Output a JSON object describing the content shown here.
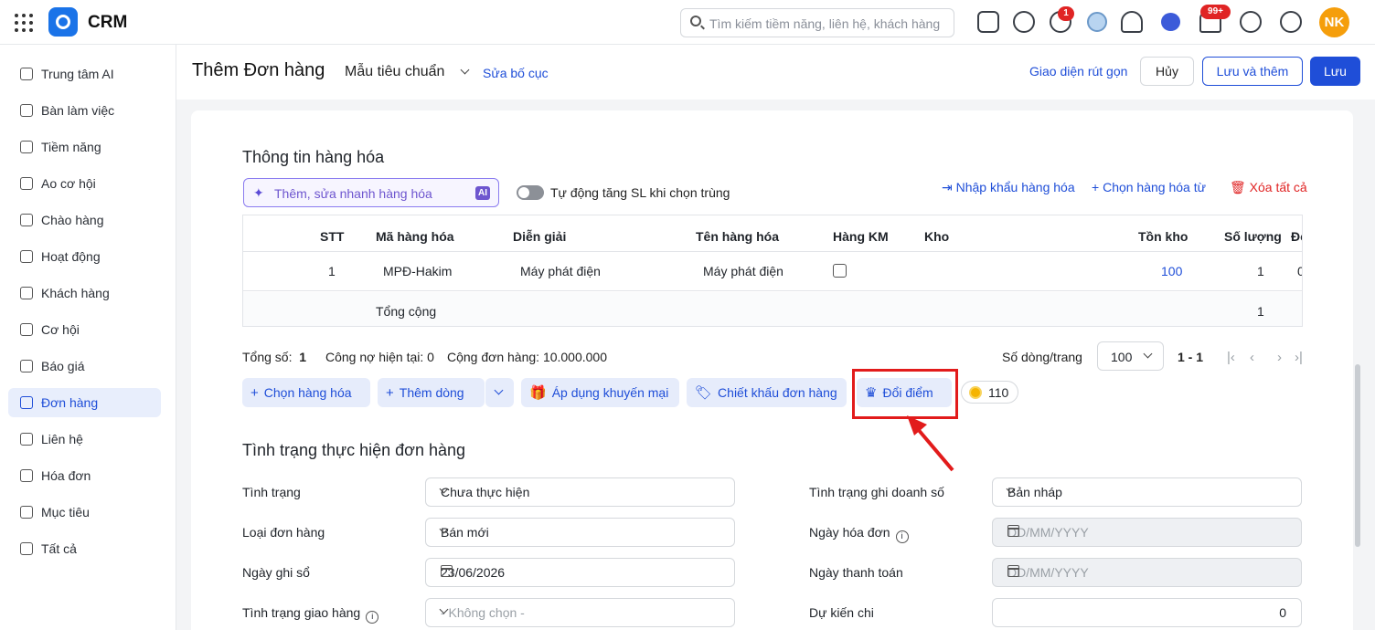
{
  "app": {
    "brand": "CRM"
  },
  "search": {
    "placeholder": "Tìm kiếm tiềm năng, liên hệ, khách hàng"
  },
  "notifications": {
    "timer_badge": "1",
    "bell_badge": "99+"
  },
  "user": {
    "initials": "NK"
  },
  "sidebar": {
    "items": [
      {
        "label": "Trung tâm AI",
        "icon": "sparkle-icon"
      },
      {
        "label": "Bàn làm việc",
        "icon": "home-icon"
      },
      {
        "label": "Tiềm năng",
        "icon": "user-circle-icon"
      },
      {
        "label": "Ao cơ hội",
        "icon": "people-icon"
      },
      {
        "label": "Chào hàng",
        "icon": "magnet-icon"
      },
      {
        "label": "Hoạt động",
        "icon": "activity-icon"
      },
      {
        "label": "Khách hàng",
        "icon": "building-icon"
      },
      {
        "label": "Cơ hội",
        "icon": "box-icon"
      },
      {
        "label": "Báo giá",
        "icon": "quote-doc-icon"
      },
      {
        "label": "Đơn hàng",
        "icon": "cart-icon"
      },
      {
        "label": "Liên hệ",
        "icon": "contact-icon"
      },
      {
        "label": "Hóa đơn",
        "icon": "invoice-icon"
      },
      {
        "label": "Mục tiêu",
        "icon": "target-icon"
      },
      {
        "label": "Tất cả",
        "icon": "menu-icon"
      }
    ],
    "active_index": 9
  },
  "header": {
    "title": "Thêm Đơn hàng",
    "template": "Mẫu tiêu chuẩn",
    "edit_layout": "Sửa bố cục",
    "compact_view": "Giao diện rút gọn",
    "cancel": "Hủy",
    "save_and_add": "Lưu và thêm",
    "save": "Lưu"
  },
  "goods": {
    "section_title": "Thông tin hàng hóa",
    "ai_placeholder": "Thêm, sửa nhanh hàng hóa",
    "ai_badge": "AI",
    "auto_increase": "Tự động tăng SL khi chọn trùng",
    "import": "Nhập khẩu hàng hóa",
    "choose_from": "Chọn hàng hóa từ",
    "delete_all": "Xóa tất cả",
    "columns": [
      "STT",
      "Mã hàng hóa",
      "Diễn giải",
      "Tên hàng hóa",
      "Hàng KM",
      "Kho",
      "Tồn kho",
      "Số lượng",
      "Đơ"
    ],
    "rows": [
      {
        "stt": "1",
        "code": "MPĐ-Hakim",
        "desc": "Máy phát điện",
        "name": "Máy phát điện",
        "stock": "100",
        "qty": "1",
        "extra": "0"
      }
    ],
    "footer_label": "Tổng cộng",
    "footer_qty": "1",
    "summary": {
      "total_label": "Tổng số:",
      "total_value": "1",
      "debt_label": "Công nợ hiện tại:",
      "debt_value": "0",
      "order_sum_label": "Cộng đơn hàng:",
      "order_sum_value": "10.000.000"
    },
    "pagination": {
      "rows_per_page_label": "Số dòng/trang",
      "rows_per_page": "100",
      "range": "1 - 1"
    },
    "actions": {
      "choose_goods": "Chọn hàng hóa",
      "add_row": "Thêm dòng",
      "apply_promo": "Áp dụng khuyến mại",
      "order_discount": "Chiết khấu đơn hàng",
      "redeem_points": "Đổi điểm",
      "points": "110"
    }
  },
  "status": {
    "section_title": "Tình trạng thực hiện đơn hàng",
    "fields_left": [
      {
        "label": "Tình trạng",
        "value": "Chưa thực hiện",
        "kind": "select"
      },
      {
        "label": "Loại đơn hàng",
        "value": "Bán mới",
        "kind": "select"
      },
      {
        "label": "Ngày ghi sổ",
        "value": "23/06/2026",
        "kind": "date"
      },
      {
        "label": "Tình trạng giao hàng",
        "value": "- Không chọn -",
        "kind": "select"
      }
    ],
    "fields_right": [
      {
        "label": "Tình trạng ghi doanh số",
        "value": "Bản nháp",
        "kind": "select"
      },
      {
        "label": "Ngày hóa đơn",
        "value": "DD/MM/YYYY",
        "kind": "date"
      },
      {
        "label": "Ngày thanh toán",
        "value": "DD/MM/YYYY",
        "kind": "date"
      },
      {
        "label": "Dự kiến chi",
        "value": "0",
        "kind": "number"
      }
    ]
  },
  "colors": {
    "primary": "#1f4ed8",
    "highlight": "#e21b1b",
    "avatar": "#f59e0b"
  }
}
